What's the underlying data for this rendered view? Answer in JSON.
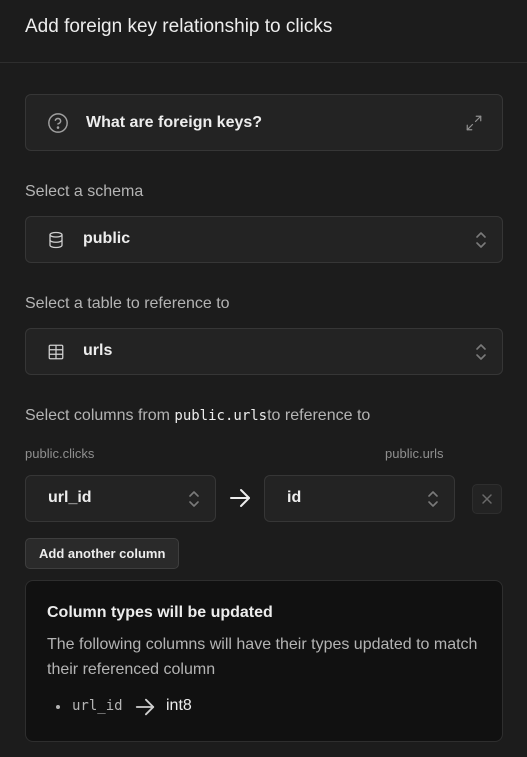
{
  "panel": {
    "title": "Add foreign key relationship to clicks"
  },
  "accordion": {
    "label": "What are foreign keys?",
    "icon": "help-circle-icon"
  },
  "schema": {
    "label": "Select a schema",
    "value": "public",
    "icon": "database-icon"
  },
  "table": {
    "label": "Select a table to reference to",
    "value": "urls",
    "icon": "table-icon"
  },
  "columns": {
    "label_prefix": "Select columns from ",
    "label_code": "public.urls",
    "label_suffix": "to reference to",
    "source_table": "public.clicks",
    "target_table": "public.urls",
    "source_value": "url_id",
    "target_value": "id",
    "add_label": "Add another column"
  },
  "notice": {
    "title": "Column types will be updated",
    "body": "The following columns will have their types updated to match their referenced column",
    "changes": [
      {
        "column": "url_id",
        "new_type": "int8"
      }
    ]
  }
}
